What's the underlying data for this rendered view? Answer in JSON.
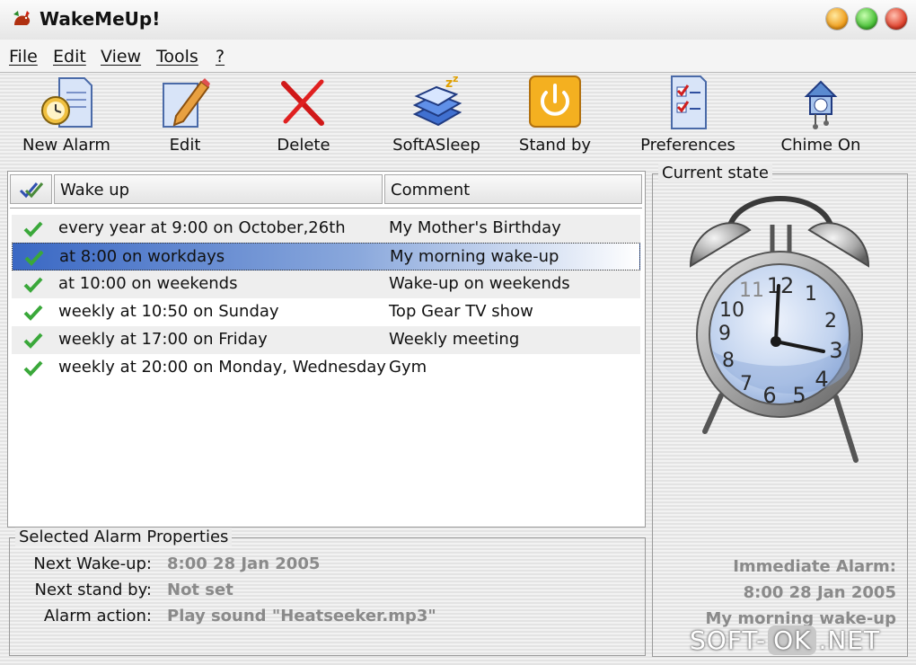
{
  "window": {
    "title": "WakeMeUp!"
  },
  "menu": [
    "File",
    "Edit",
    "View",
    "Tools",
    "?"
  ],
  "toolbar": {
    "new_alarm": "New Alarm",
    "edit": "Edit",
    "delete": "Delete",
    "soft_a_sleep": "SoftASleep",
    "stand_by": "Stand by",
    "preferences": "Preferences",
    "chime_on": "Chime On"
  },
  "alarm_list": {
    "columns": {
      "wake_up": "Wake up",
      "comment": "Comment"
    },
    "rows": [
      {
        "wake_up": "every year at 9:00 on October,26th",
        "comment": "My Mother's Birthday",
        "checked": true
      },
      {
        "wake_up": "at 8:00 on workdays",
        "comment": "My morning wake-up",
        "checked": true
      },
      {
        "wake_up": "at 10:00 on weekends",
        "comment": "Wake-up on weekends",
        "checked": true
      },
      {
        "wake_up": "weekly at 10:50 on Sunday",
        "comment": "Top Gear TV show",
        "checked": true
      },
      {
        "wake_up": "weekly at 17:00 on Friday",
        "comment": "Weekly meeting",
        "checked": true
      },
      {
        "wake_up": "weekly at 20:00 on Monday, Wednesday",
        "comment": "Gym",
        "checked": true
      }
    ],
    "selected_index": 1
  },
  "properties": {
    "title": "Selected Alarm Properties",
    "next_wakeup_label": "Next Wake-up:",
    "next_wakeup_value": "8:00 28 Jan 2005",
    "next_standby_label": "Next stand by:",
    "next_standby_value": "Not set",
    "alarm_action_label": "Alarm action:",
    "alarm_action_value": "Play sound \"Heatseeker.mp3\""
  },
  "current_state": {
    "title": "Current state",
    "clock_numbers": [
      "12",
      "1",
      "2",
      "3",
      "4",
      "5",
      "6",
      "7",
      "8",
      "9",
      "10",
      "11"
    ],
    "immediate_label": "Immediate Alarm:",
    "immediate_time": "8:00 28 Jan 2005",
    "immediate_comment": "My morning wake-up"
  },
  "watermark": {
    "left": "SOFT-",
    "mid": "OK",
    "right": ".NET"
  },
  "colors": {
    "selection": "#3a68c4",
    "check": "#3aa83a",
    "prop_value": "#8a8a8a"
  }
}
